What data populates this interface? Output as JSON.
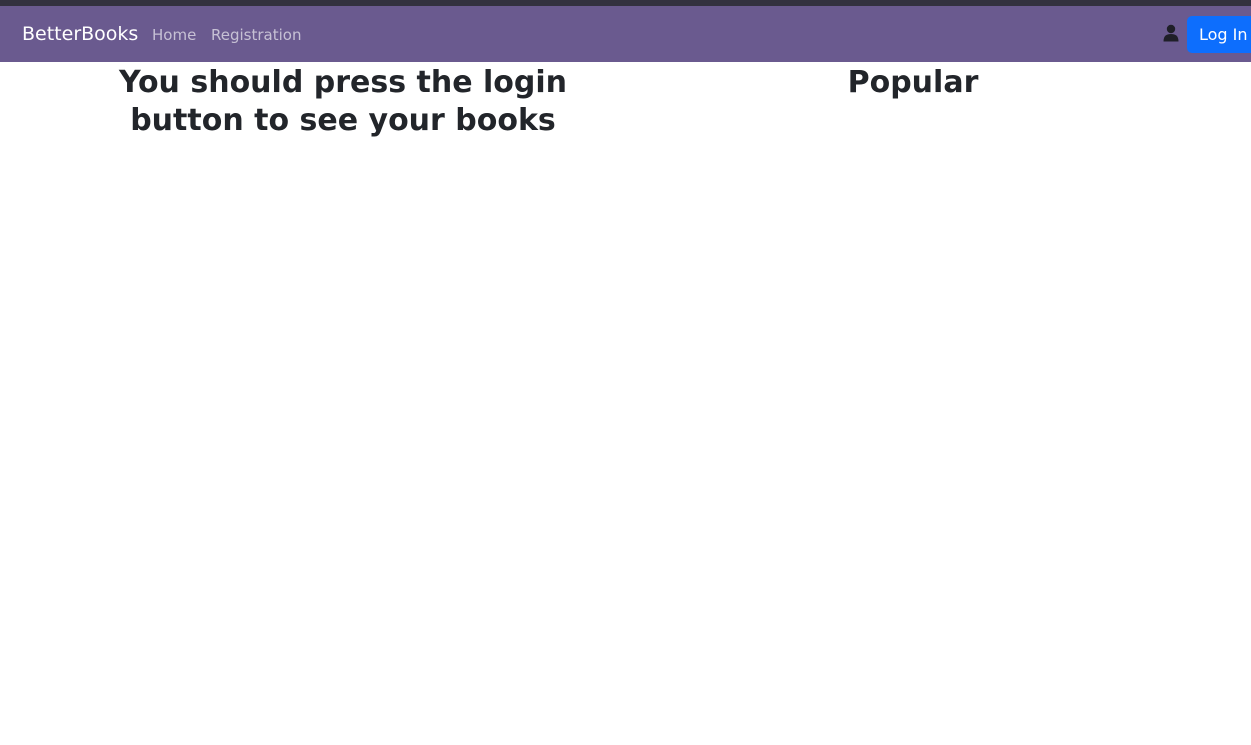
{
  "navbar": {
    "brand": "BetterBooks",
    "links": [
      {
        "label": "Home"
      },
      {
        "label": "Registration"
      }
    ],
    "user_icon": "user-icon",
    "login_label": "Log In"
  },
  "main": {
    "left_heading": "You should press the login button to see your books",
    "right_heading": "Popular"
  },
  "colors": {
    "navbar_bg": "#6a5a8f",
    "top_strip": "#33313f",
    "login_button": "#0d6efd",
    "heading_text": "#22252a"
  }
}
